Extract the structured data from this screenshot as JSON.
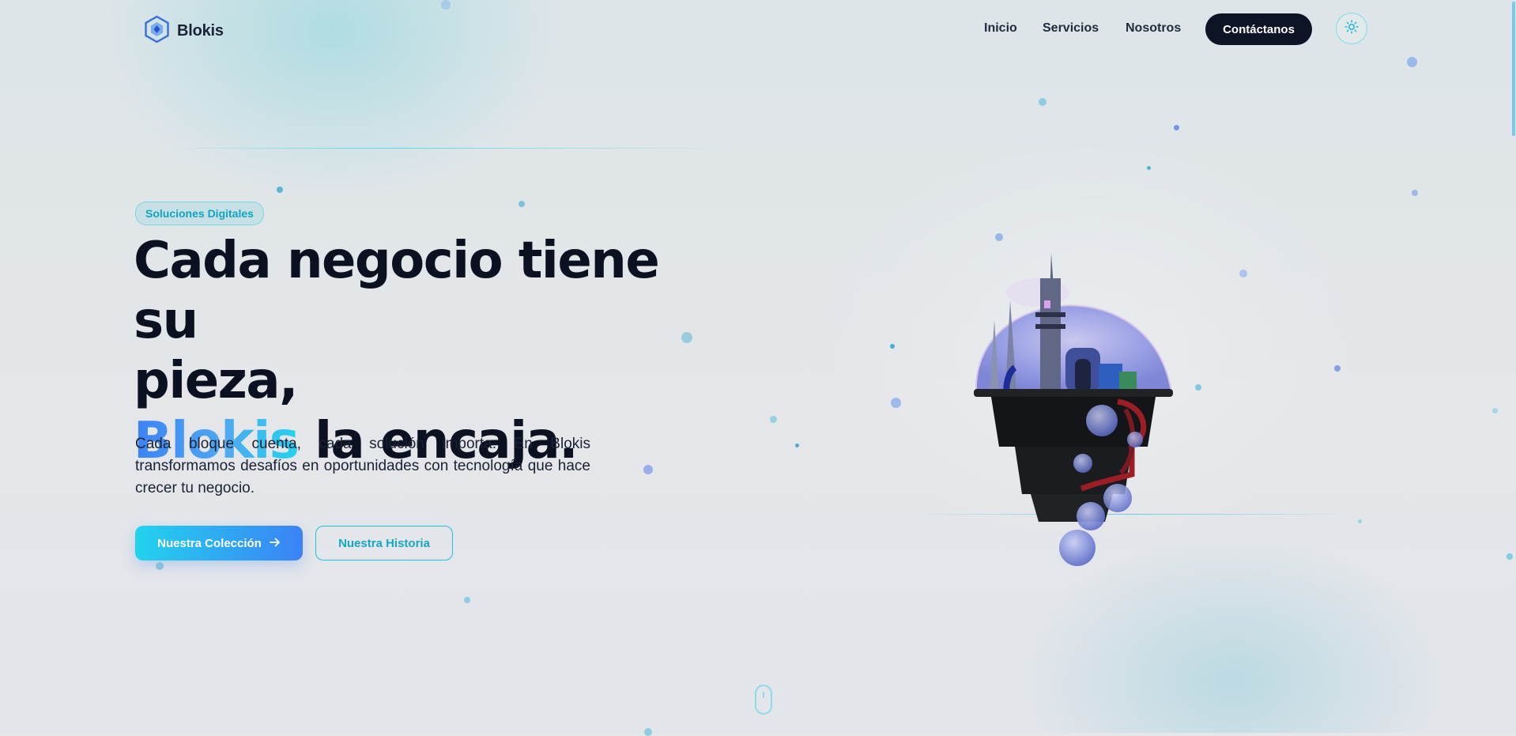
{
  "brand": {
    "name": "Blokis",
    "logo_icon": "hexagon-cube-icon",
    "accent": "#3b82f6",
    "accent_cyan": "#22d3ee",
    "dark": "#0d1426"
  },
  "nav": {
    "links": [
      {
        "label": "Inicio"
      },
      {
        "label": "Servicios"
      },
      {
        "label": "Nosotros"
      }
    ],
    "cta_label": "Contáctanos",
    "theme_icon": "sun-icon"
  },
  "hero": {
    "badge": "Soluciones Digitales",
    "headline_line1": "Cada negocio tiene su",
    "headline_line2": "pieza,",
    "headline_accent": "Blokis",
    "headline_rest": " la encaja.",
    "description": "Cada bloque cuenta, cada solución importa. En Blokis transformamos desafíos en oportunidades con tecnología que hace crecer tu negocio.",
    "primary_button": "Nuestra Colección",
    "primary_button_icon": "arrow-right-icon",
    "secondary_button": "Nuestra Historia"
  },
  "scroll_indicator_icon": "mouse-icon",
  "hero_image": "floating-globe-city-3d"
}
